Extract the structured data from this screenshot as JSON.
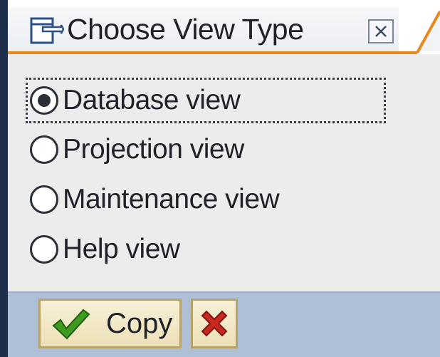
{
  "dialog": {
    "title": "Choose View Type",
    "title_icon": "dialog-window-icon",
    "close_icon": "close-x-icon"
  },
  "options": [
    {
      "label": "Database view",
      "selected": true
    },
    {
      "label": "Projection view",
      "selected": false
    },
    {
      "label": "Maintenance view",
      "selected": false
    },
    {
      "label": "Help view",
      "selected": false
    }
  ],
  "footer": {
    "copy_label": "Copy",
    "copy_icon": "green-check-icon",
    "cancel_icon": "red-x-icon"
  },
  "colors": {
    "accent_orange": "#e48a1c",
    "footer_blue": "#aebfd6",
    "left_bar_navy": "#1d2f4a",
    "check_green": "#3f9b1f",
    "cancel_red": "#c8281e"
  }
}
